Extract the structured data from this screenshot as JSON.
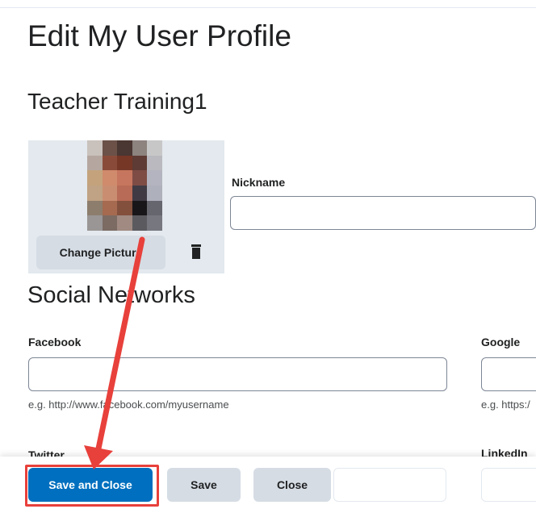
{
  "page": {
    "title": "Edit My User Profile",
    "user_name": "Teacher Training1"
  },
  "picture": {
    "change_label": "Change Picture",
    "delete_icon": "trash-icon"
  },
  "nickname": {
    "label": "Nickname",
    "value": ""
  },
  "social": {
    "title": "Social Networks",
    "facebook": {
      "label": "Facebook",
      "value": "",
      "hint": "e.g. http://www.facebook.com/myusername"
    },
    "google": {
      "label": "Google",
      "value": "",
      "hint": "e.g. https:/"
    },
    "twitter": {
      "label": "Twitter"
    },
    "linkedin": {
      "label": "LinkedIn"
    }
  },
  "footer": {
    "save_and_close": "Save and Close",
    "save": "Save",
    "close": "Close"
  },
  "annotation": {
    "arrow_color": "#e8403b",
    "highlight_color": "#e8403b"
  },
  "colors": {
    "primary": "#006fbf",
    "secondary": "#d5dce4",
    "panel": "#e3e9ee"
  }
}
